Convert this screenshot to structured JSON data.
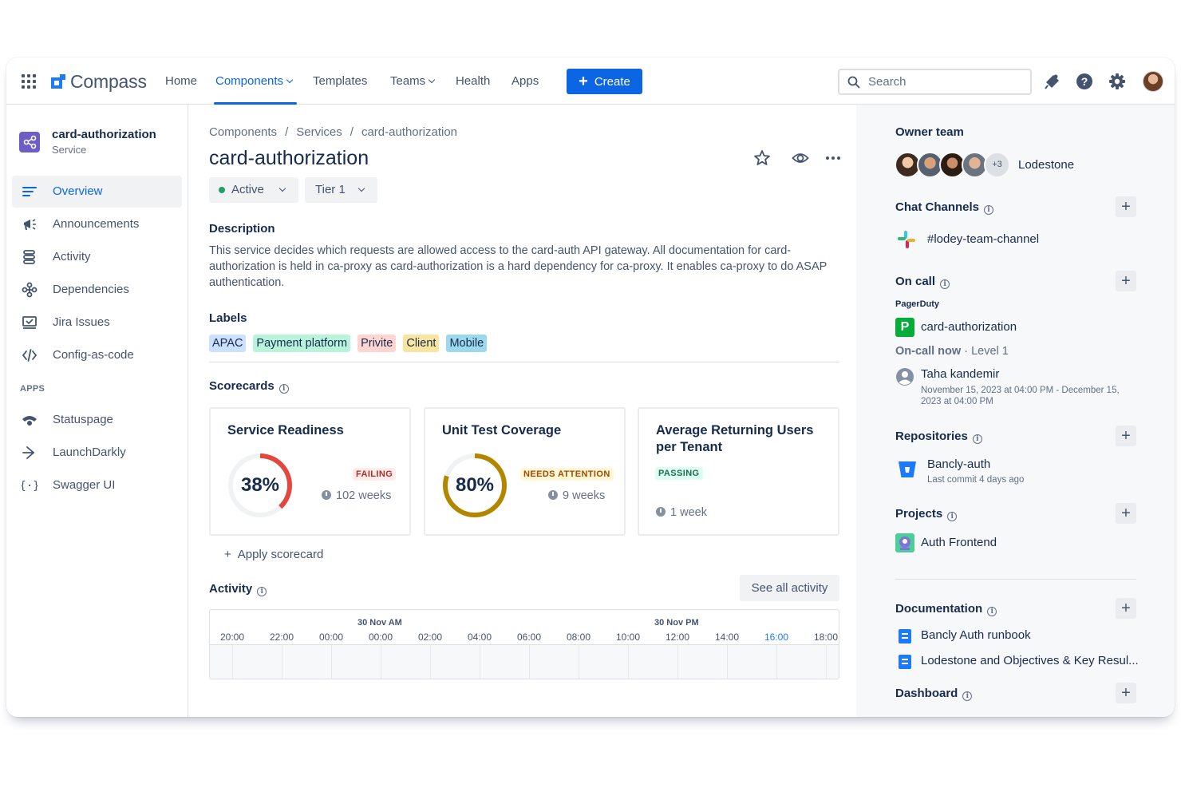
{
  "topnav": {
    "logo_text": "Compass",
    "items": [
      {
        "label": "Home"
      },
      {
        "label": "Components"
      },
      {
        "label": "Templates"
      },
      {
        "label": "Teams"
      },
      {
        "label": "Health"
      },
      {
        "label": "Apps"
      }
    ],
    "active_item": "Components",
    "create_label": "Create",
    "search_placeholder": "Search",
    "icons": [
      "apps-grid-icon",
      "notifications-icon",
      "help-icon",
      "settings-icon",
      "avatar"
    ]
  },
  "sidebar": {
    "component_name": "card-authorization",
    "component_type": "Service",
    "items": [
      {
        "label": "Overview",
        "icon": "overview-icon"
      },
      {
        "label": "Announcements",
        "icon": "megaphone-icon"
      },
      {
        "label": "Activity",
        "icon": "activity-icon"
      },
      {
        "label": "Dependencies",
        "icon": "dependencies-icon"
      },
      {
        "label": "Jira Issues",
        "icon": "jira-issues-icon"
      },
      {
        "label": "Config-as-code",
        "icon": "code-icon"
      }
    ],
    "apps_heading": "APPS",
    "apps": [
      {
        "label": "Statuspage",
        "icon": "statuspage-icon"
      },
      {
        "label": "LaunchDarkly",
        "icon": "launchdarkly-icon"
      },
      {
        "label": "Swagger UI",
        "icon": "swagger-icon"
      }
    ]
  },
  "main": {
    "breadcrumb": [
      "Components",
      "Services",
      "card-authorization"
    ],
    "breadcrumb_sep": "/",
    "title": "card-authorization",
    "status": "Active",
    "tier": "Tier 1",
    "description_heading": "Description",
    "description": "This service decides which requests are allowed access to the card-auth API gateway. All documentation for card-authorization is held in ca-proxy as card-authorization is a hard dependency for ca-proxy. It enables ca-proxy to do ASAP authentication.",
    "labels_heading": "Labels",
    "labels": [
      {
        "text": "APAC",
        "color": "#cce0ff"
      },
      {
        "text": "Payment platform",
        "color": "#baf3db"
      },
      {
        "text": "Privite",
        "color": "#ffd5d2"
      },
      {
        "text": "Client",
        "color": "#f8e6a0"
      },
      {
        "text": "Mobile",
        "color": "#9dd9ee"
      }
    ],
    "scorecards_heading": "Scorecards",
    "scorecards": [
      {
        "title": "Service Readiness",
        "percent": "38%",
        "value": 38,
        "status": "FAILING",
        "status_bg": "#ffeceb",
        "status_fg": "#ae2e24",
        "ring_color": "#e2483d",
        "time": "102 weeks"
      },
      {
        "title": "Unit Test Coverage",
        "percent": "80%",
        "value": 80,
        "status": "NEEDS ATTENTION",
        "status_bg": "#fff7d6",
        "status_fg": "#a54800",
        "ring_color": "#b38600",
        "time": "9 weeks"
      },
      {
        "title": "Average Returning Users per Tenant",
        "status": "PASSING",
        "status_bg": "#dcfff1",
        "status_fg": "#216e4e",
        "time": "1 week"
      }
    ],
    "apply_scorecard": "Apply scorecard",
    "activity_heading": "Activity",
    "see_all": "See all activity",
    "timeline": {
      "day_labels": [
        "30 Nov AM",
        "30 Nov PM"
      ],
      "hours": [
        "20:00",
        "22:00",
        "00:00",
        "00:00",
        "02:00",
        "04:00",
        "06:00",
        "08:00",
        "10:00",
        "12:00",
        "14:00",
        "16:00",
        "18:00"
      ],
      "highlight_hour": "16:00"
    }
  },
  "right": {
    "owner_heading": "Owner team",
    "team_name": "Lodestone",
    "team_more": "+3",
    "chat_heading": "Chat Channels",
    "chat_channel": "#lodey-team-channel",
    "oncall_heading": "On call",
    "oncall_provider": "PagerDuty",
    "oncall_service": "card-authorization",
    "oncall_service_initial": "P",
    "oncall_now": "On-call now",
    "oncall_level": "Level 1",
    "oncall_person": "Taha kandemir",
    "oncall_period": "November 15, 2023 at 04:00 PM - December 15, 2023 at 04:00 PM",
    "repos_heading": "Repositories",
    "repo_name": "Bancly-auth",
    "repo_commit": "Last commit 4 days ago",
    "projects_heading": "Projects",
    "project_name": "Auth Frontend",
    "docs_heading": "Documentation",
    "docs": [
      "Bancly Auth runbook",
      "Lodestone and Objectives & Key Resul..."
    ],
    "dashboard_heading": "Dashboard"
  }
}
